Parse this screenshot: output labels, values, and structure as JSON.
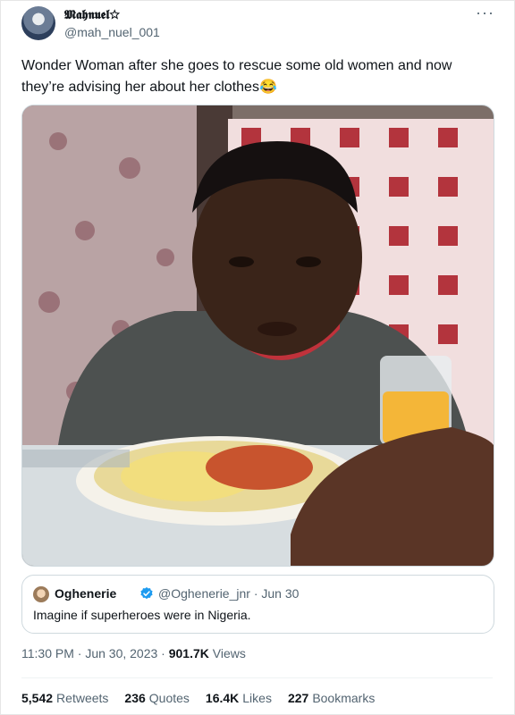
{
  "author": {
    "display_name": "𝕸𝖆𝖍𝖓𝖚𝖊𝖑☆",
    "handle": "@mah_nuel_001"
  },
  "tweet": {
    "text": "Wonder Woman after she goes to rescue some old women and now they’re advising her about her clothes😂"
  },
  "more_icon": "more-horizontal-icon",
  "quote": {
    "name": "Oghenerie",
    "handle_date": "@Oghenerie_jnr · Jun 30",
    "text": "Imagine if superheroes were in Nigeria.",
    "verified_color": "#1d9bf0"
  },
  "meta": {
    "time_date": "11:30 PM · Jun 30, 2023 · ",
    "views_count": "901.7K",
    "views_label": " Views"
  },
  "stats": [
    {
      "count": "5,542",
      "label": "Retweets"
    },
    {
      "count": "236",
      "label": "Quotes"
    },
    {
      "count": "16.4K",
      "label": "Likes"
    },
    {
      "count": "227",
      "label": "Bookmarks"
    }
  ]
}
